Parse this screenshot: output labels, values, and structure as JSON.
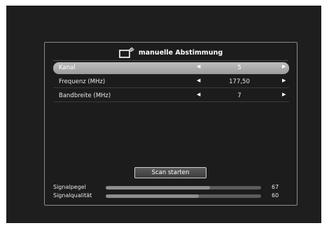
{
  "title": "manuelle Abstimmung",
  "rows": [
    {
      "label": "Kanal",
      "value": "5",
      "arrow_left": "◀",
      "arrow_right": "▶"
    },
    {
      "label": "Frequenz (MHz)",
      "value": "177,50",
      "arrow_left": "◀",
      "arrow_right": "▶"
    },
    {
      "label": "Bandbreite (MHz)",
      "value": "7",
      "arrow_left": "◀",
      "arrow_right": "▶"
    }
  ],
  "scan_button": "Scan starten",
  "signal_level": {
    "label": "Signalpegel",
    "value": "67",
    "fraction": 0.67
  },
  "signal_quality": {
    "label": "Signalqualität",
    "value": "60",
    "fraction": 0.6
  },
  "icons": {
    "title_icon": "tv-antenna-icon"
  },
  "colors": {
    "background": "#1e1e1e",
    "selected_row": "#b0b0b0",
    "panel_border": "#8a8a8a"
  }
}
